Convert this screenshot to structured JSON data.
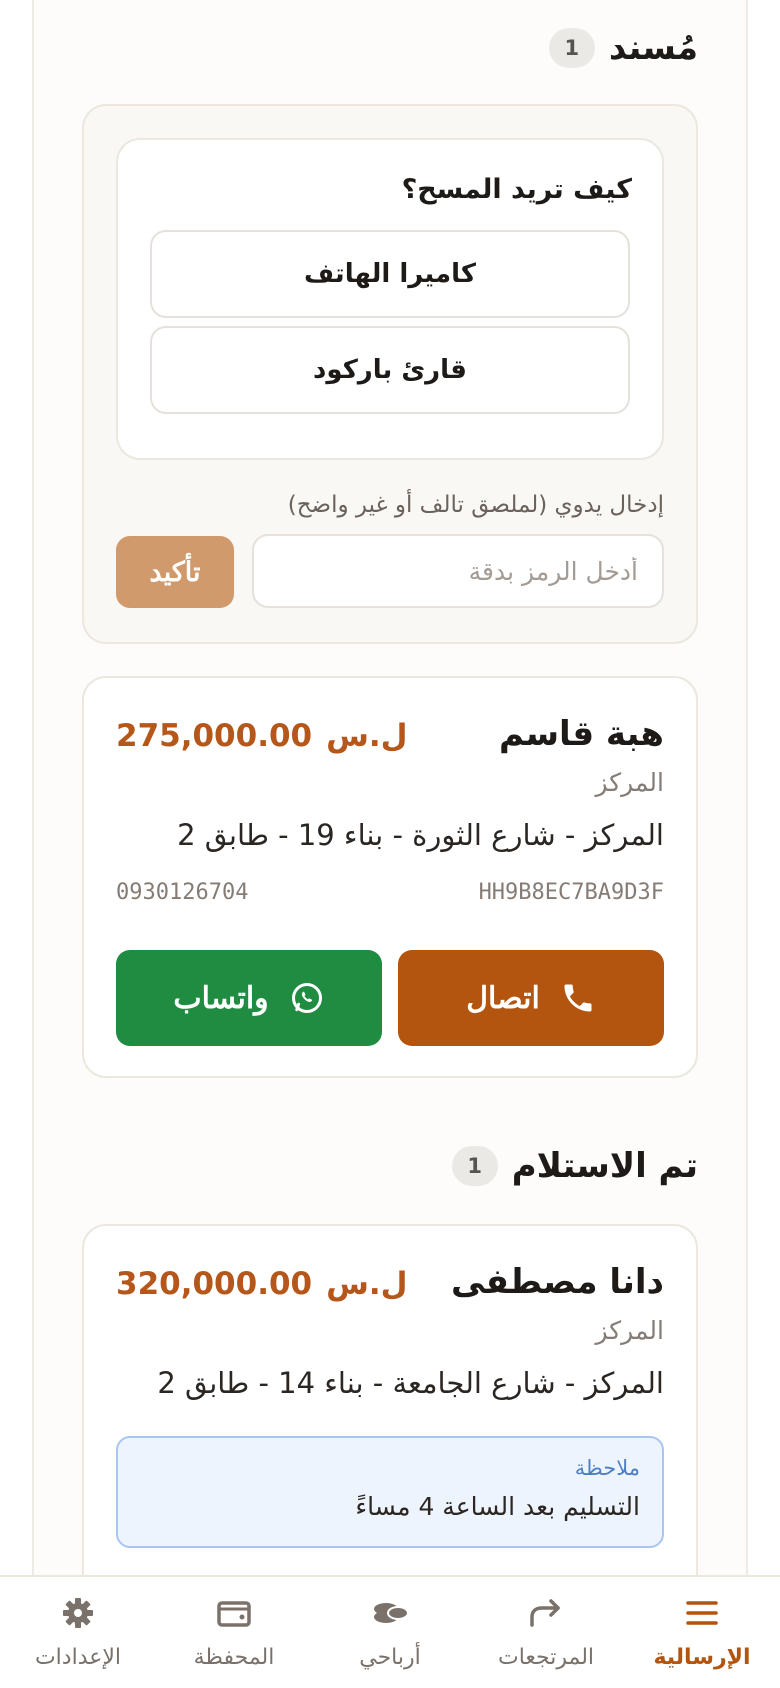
{
  "sections": {
    "assigned": {
      "title": "مُسند",
      "count": "1"
    },
    "received": {
      "title": "تم الاستلام",
      "count": "1"
    }
  },
  "scan": {
    "question": "كيف تريد المسح؟",
    "phone_camera": "كاميرا الهاتف",
    "barcode_reader": "قارئ باركود",
    "manual_label": "إدخال يدوي (لملصق تالف أو غير واضح)",
    "manual_placeholder": "أدخل الرمز بدقة",
    "confirm_label": "تأكيد"
  },
  "orders": [
    {
      "name": "هبة قاسم",
      "amount": "275,000.00",
      "currency": "ل.س",
      "area": "المركز",
      "address": "المركز - شارع الثورة - بناء 19 - طابق 2",
      "code": "HH9B8EC7BA9D3F",
      "phone": "0930126704",
      "call_label": "اتصال",
      "whatsapp_label": "واتساب"
    },
    {
      "name": "دانا مصطفى",
      "amount": "320,000.00",
      "currency": "ل.س",
      "area": "المركز",
      "address": "المركز - شارع الجامعة - بناء 14 - طابق 2",
      "note_label": "ملاحظة",
      "note_text": "التسليم بعد الساعة 4 مساءً"
    }
  ],
  "tabs": [
    {
      "label": "الإرسالية",
      "icon": "menu-icon",
      "active": true
    },
    {
      "label": "المرتجعات",
      "icon": "return-arrow-icon",
      "active": false
    },
    {
      "label": "أرباحي",
      "icon": "coins-icon",
      "active": false
    },
    {
      "label": "المحفظة",
      "icon": "wallet-icon",
      "active": false
    },
    {
      "label": "الإعدادات",
      "icon": "gear-icon",
      "active": false
    }
  ],
  "colors": {
    "accent": "#b3550f",
    "confirm": "#d09a6c",
    "whatsapp": "#1f8c42",
    "note_border": "#a8c6ef"
  }
}
